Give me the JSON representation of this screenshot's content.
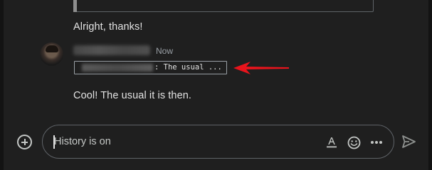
{
  "messages": [
    {
      "text": "Alright, thanks!"
    },
    {
      "timestamp": "Now",
      "quote_text": ": The usual ..."
    },
    {
      "text": "Cool! The usual it is then."
    }
  ],
  "composer": {
    "placeholder": "History is on"
  },
  "icons": {
    "add": "add-circle-icon",
    "format": "text-format-icon",
    "emoji": "emoji-icon",
    "more": "more-horiz-icon",
    "send": "send-icon"
  },
  "colors": {
    "background": "#1f1f1f",
    "text": "#e3e3e3",
    "muted": "#9aa0a6",
    "border": "#5f6368",
    "annotation_arrow": "#e8141c"
  }
}
